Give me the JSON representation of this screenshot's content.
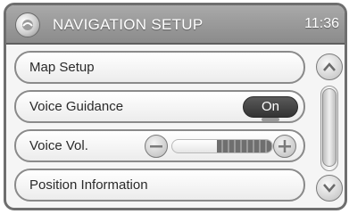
{
  "header": {
    "title": "NAVIGATION SETUP",
    "time": "11:36",
    "logo_icon": "app-logo-icon"
  },
  "menu": {
    "items": [
      {
        "label": "Map Setup"
      },
      {
        "label": "Voice Guidance",
        "toggle_value": "On"
      },
      {
        "label": "Voice Vol.",
        "volume_level": 0.55,
        "decrease_icon": "minus-icon",
        "increase_icon": "plus-icon"
      },
      {
        "label": "Position Information"
      }
    ]
  },
  "scrollbar": {
    "up_icon": "chevron-up-icon",
    "down_icon": "chevron-down-icon"
  },
  "colors": {
    "header_bg": "#9a9a9a",
    "frame_border": "#6e6e6e",
    "toggle_bg": "#3f3f3f"
  }
}
